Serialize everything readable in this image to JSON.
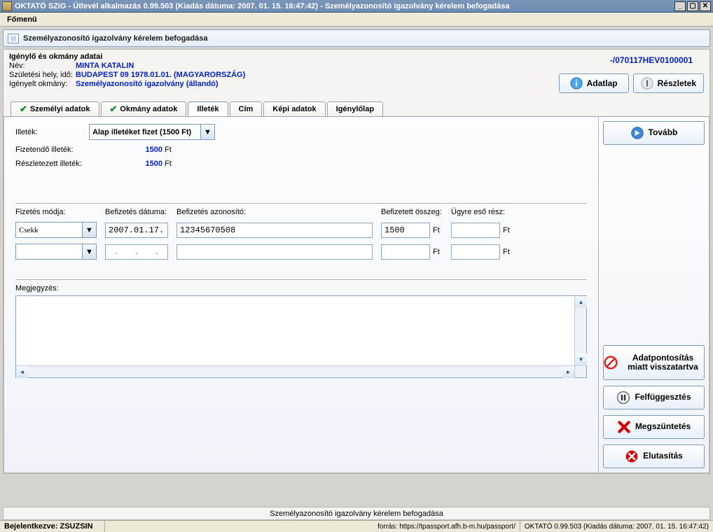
{
  "window": {
    "title": "OKTATÓ SZIG - Útlevél alkalmazás 0.99.503 (Kiadás dátuma: 2007. 01. 15. 16:47:42) - Személyazonosító igazolvány kérelem befogadása"
  },
  "menubar": {
    "main": "Főmenü"
  },
  "subheader": {
    "title": "Személyazonosító igazolvány kérelem befogadása"
  },
  "applicant": {
    "section": "Igénylő és okmány adatai",
    "name_label": "Név:",
    "name": "MINTA KATALIN",
    "birth_label": "Születési hely, idő:",
    "birth": "BUDAPEST 09 1978.01.01.  (MAGYARORSZÁG)",
    "doc_label": "Igényelt okmány:",
    "doc": "Személyazonosító igazolvány (állandó)",
    "request_id": "-/070117HEV0100001"
  },
  "topbuttons": {
    "datasheet": "Adatlap",
    "details": "Részletek"
  },
  "tabs": {
    "personal": "Személyi adatok",
    "document": "Okmány adatok",
    "fee": "Illeték",
    "address": "Cím",
    "image": "Képi adatok",
    "form": "Igénylőlap"
  },
  "fee": {
    "label": "Illeték:",
    "combo": "Alap illetéket fizet (1500 Ft)",
    "payable_label": "Fizetendő illeték:",
    "payable_value": "1500",
    "ft": "Ft",
    "detailed_label": "Részletezett illeték:",
    "detailed_value": "1500",
    "payment": {
      "mode_label": "Fizetés módja:",
      "mode": "Csekk",
      "date_label": "Befizetés dátuma:",
      "date": "2007.01.17.",
      "id_label": "Befizetés azonosító:",
      "id": "12345670508",
      "amount_label": "Befizetett összeg:",
      "amount": "1500",
      "case_label": "Ügyre eső rész:",
      "row2_date": ".   .   ."
    },
    "note_label": "Megjegyzés:"
  },
  "side": {
    "next": "Tovább",
    "hold": "Adatpontosítás miatt visszatartva",
    "suspend": "Felfüggesztés",
    "terminate": "Megszüntetés",
    "reject": "Elutasítás"
  },
  "footer": {
    "text": "Személyazonosító igazolvány kérelem befogadása"
  },
  "status": {
    "login": "Bejelentkezve: ZSUZSIN",
    "source": "forrás: https://tpassport.afh.b-m.hu/passport/",
    "version": "OKTATÓ 0.99.503 (Kiadás dátuma: 2007. 01. 15. 16:47:42)"
  }
}
